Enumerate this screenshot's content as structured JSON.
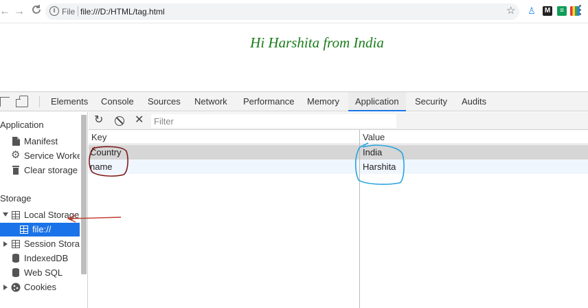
{
  "browser": {
    "back_glyph": "←",
    "forward_glyph": "→",
    "reload_glyph": "C",
    "scheme_label": "File",
    "url": "file:///D:/HTML/tag.html",
    "star_glyph": "☆",
    "extensions": [
      {
        "icon": "person-icon",
        "color": "#1e88e5",
        "glyph": "♙"
      },
      {
        "icon": "medium-icon",
        "color": "#222222",
        "glyph": "M"
      },
      {
        "icon": "sheets-icon",
        "color": "#0f9d58",
        "glyph": "≡"
      },
      {
        "icon": "color-bars-icon",
        "color": "#e53935",
        "glyph": ""
      }
    ]
  },
  "page": {
    "heading": "Hi Harshita from India"
  },
  "devtools": {
    "tabs": [
      {
        "label": "Elements",
        "active": false
      },
      {
        "label": "Console",
        "active": false
      },
      {
        "label": "Sources",
        "active": false
      },
      {
        "label": "Network",
        "active": false
      },
      {
        "label": "Performance",
        "active": false
      },
      {
        "label": "Memory",
        "active": false
      },
      {
        "label": "Application",
        "active": true
      },
      {
        "label": "Security",
        "active": false
      },
      {
        "label": "Audits",
        "active": false
      }
    ],
    "sidebar": {
      "application_title": "Application",
      "application_items": [
        {
          "label": "Manifest",
          "icon": "document-icon"
        },
        {
          "label": "Service Workers",
          "icon": "gear-icon"
        },
        {
          "label": "Clear storage",
          "icon": "trash-icon"
        }
      ],
      "storage_title": "Storage",
      "storage_items": [
        {
          "label": "Local Storage",
          "icon": "grid-icon",
          "expander": "down"
        },
        {
          "label": "file://",
          "icon": "grid-icon",
          "selected": true,
          "indent": true
        },
        {
          "label": "Session Storage",
          "icon": "grid-icon",
          "expander": "right"
        },
        {
          "label": "IndexedDB",
          "icon": "database-icon"
        },
        {
          "label": "Web SQL",
          "icon": "database-icon"
        },
        {
          "label": "Cookies",
          "icon": "cookie-icon",
          "expander": "right"
        }
      ]
    },
    "toolbar": {
      "refresh_glyph": "↻",
      "clear_glyph": "✕",
      "filter_placeholder": "Filter"
    },
    "table": {
      "columns": [
        "Key",
        "Value"
      ],
      "rows": [
        {
          "key": "Country",
          "value": "India",
          "selected": true
        },
        {
          "key": "name",
          "value": "Harshita",
          "selected": false
        }
      ]
    }
  },
  "annotations": {
    "key_circle_color": "#7b1a1a",
    "value_circle_color": "#29a3dd",
    "arrow_color": "#c0392b"
  },
  "colors": {
    "accent": "#1a73e8",
    "heading": "#1a7c1a",
    "row_selected": "#d6d6d6",
    "row_alt": "#f0f6fd"
  }
}
